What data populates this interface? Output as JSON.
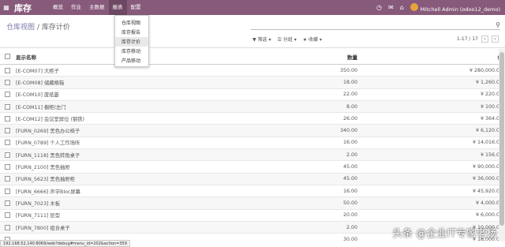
{
  "topbar": {
    "brand": "库存",
    "menu": [
      "概览",
      "作业",
      "主数据",
      "报表",
      "配置"
    ],
    "active_menu": "报表",
    "user": "Mitchell Admin (odoo12_demo)"
  },
  "dropdown": {
    "items": [
      "仓库视图",
      "库存报告",
      "库存计价",
      "库存移动",
      "产品移动"
    ],
    "active": "库存计价"
  },
  "breadcrumb": {
    "parent": "仓库视图",
    "sep": "/",
    "current": "库存计价"
  },
  "filters": {
    "filter": "筛选",
    "group": "分组",
    "favorites": "收藏"
  },
  "pager": {
    "text": "1-17 / 17"
  },
  "table": {
    "headers": {
      "name": "显示名称",
      "qty": "数量",
      "value": "值"
    },
    "rows": [
      {
        "name": "[E-COM07] 大柜子",
        "qty": "350.00",
        "value": "¥ 280,000.00"
      },
      {
        "name": "[E-COM08] 储藏格箱",
        "qty": "18.00",
        "value": "¥ 1,260.00"
      },
      {
        "name": "[E-COM10] 废纸篓",
        "qty": "22.00",
        "value": "¥ 220.00"
      },
      {
        "name": "[E-COM11] 橱柜(左门",
        "qty": "8.00",
        "value": "¥ 100.00"
      },
      {
        "name": "[E-COM12] 会议室屏位 (钢铁)",
        "qty": "26.00",
        "value": "¥ 364.00"
      },
      {
        "name": "[FURN_0269] 黑色办公椅子",
        "qty": "340.00",
        "value": "¥ 6,120.00"
      },
      {
        "name": "[FURN_0789] 个人工作场所",
        "qty": "16.00",
        "value": "¥ 14,016.00"
      },
      {
        "name": "[FURN_1118] 黑色转角桌子",
        "qty": "2.00",
        "value": "¥ 156.00"
      },
      {
        "name": "[FURN_2100] 黑色抽屉",
        "qty": "45.00",
        "value": "¥ 90,000.00"
      },
      {
        "name": "[FURN_5623] 黑色抽屉柜",
        "qty": "45.00",
        "value": "¥ 36,000.00"
      },
      {
        "name": "[FURN_6666] 声学Bloc屏幕",
        "qty": "16.00",
        "value": "¥ 45,920.00"
      },
      {
        "name": "[FURN_7023] 木板",
        "qty": "50.00",
        "value": "¥ 4,000.00"
      },
      {
        "name": "[FURN_7111] 层型",
        "qty": "20.00",
        "value": "¥ 6,000.00"
      },
      {
        "name": "[FURN_7800] 组合桌子",
        "qty": "2.00",
        "value": "¥ 10,000.00"
      },
      {
        "name": "",
        "qty": "30.00",
        "value": "¥ 18,000.00"
      }
    ]
  },
  "status_url": "192.168.52.140:8069/web?debug#menu_id=202&action=359",
  "watermark": "头条 @企业IT专家老杨",
  "colors": {
    "topbar": "#875a7b",
    "link": "#7c7bad"
  }
}
